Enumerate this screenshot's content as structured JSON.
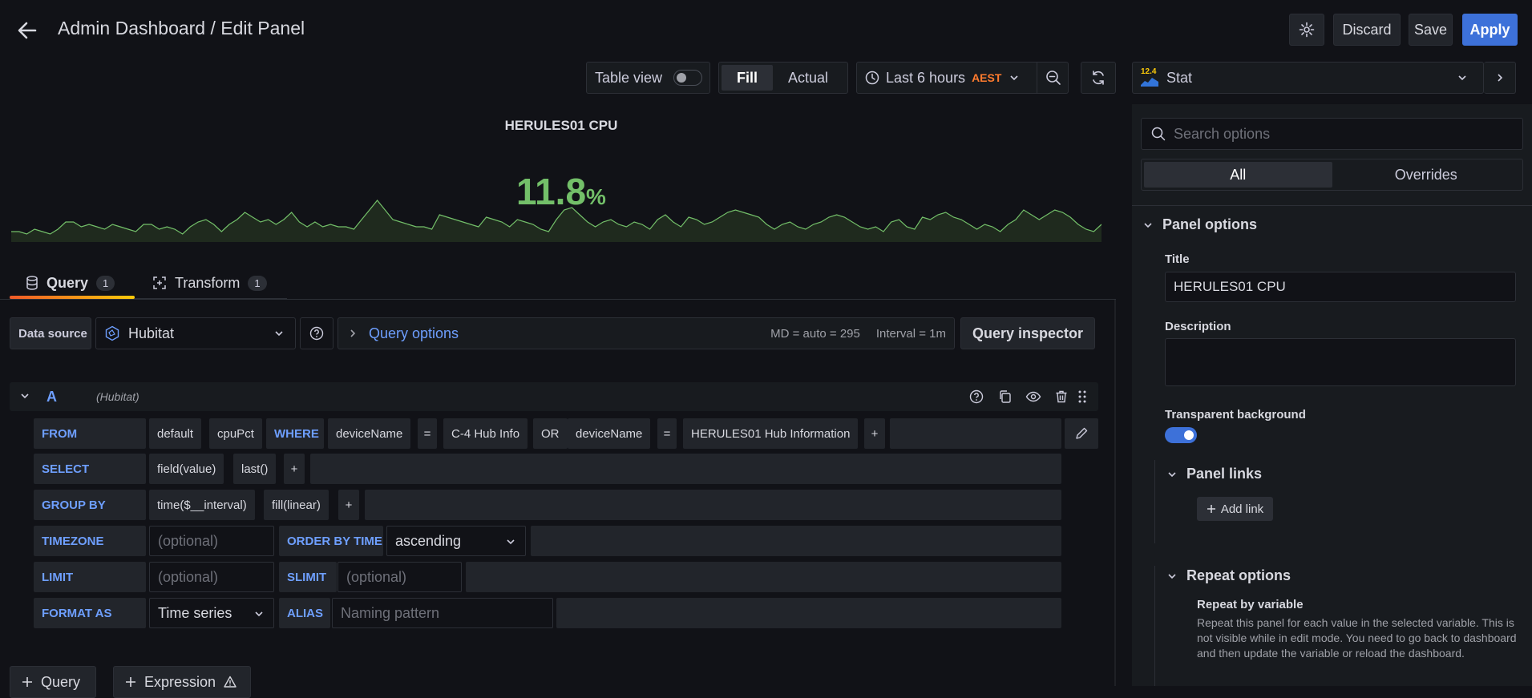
{
  "header": {
    "title": "Admin Dashboard / Edit Panel",
    "discard_label": "Discard",
    "save_label": "Save",
    "apply_label": "Apply"
  },
  "toolbar": {
    "table_view_label": "Table view",
    "table_view_on": false,
    "fill_label": "Fill",
    "actual_label": "Actual",
    "time_range": "Last 6 hours",
    "timezone": "AEST"
  },
  "viz_picker": {
    "badge": "12.4",
    "name": "Stat"
  },
  "panel": {
    "title": "HERULES01 CPU",
    "value": "11.8",
    "unit": "%",
    "accent": "#73bf69",
    "sparkline": [
      3,
      3,
      2,
      4,
      3,
      2,
      4,
      7,
      7,
      5,
      6,
      5,
      4,
      6,
      5,
      4,
      3,
      6,
      6,
      4,
      5,
      4,
      2,
      5,
      7,
      8,
      6,
      3,
      6,
      8,
      11,
      9,
      7,
      8,
      6,
      8,
      11,
      7,
      5,
      7,
      5,
      6,
      5,
      5,
      4,
      8,
      12,
      16,
      12,
      8,
      7,
      6,
      5,
      5,
      4,
      10,
      9,
      8,
      7,
      6,
      5,
      9,
      8,
      7,
      5,
      8,
      7,
      6,
      4,
      3,
      8,
      12,
      13,
      10,
      7,
      5,
      7,
      8,
      6,
      5,
      7,
      6,
      4,
      8,
      10,
      7,
      5,
      9,
      8,
      6,
      7,
      9,
      11,
      12,
      11,
      10,
      9,
      6,
      4,
      6,
      7,
      5,
      4,
      6,
      7,
      9,
      10,
      9,
      7,
      5,
      4,
      5,
      3,
      7,
      8,
      5,
      4,
      9,
      8,
      10,
      11,
      9,
      8,
      6,
      4,
      6,
      5,
      3,
      6,
      8,
      12,
      10,
      8,
      10,
      12,
      11,
      9,
      6,
      4,
      3,
      6
    ],
    "fill_color": "#1f2a1e",
    "line_color": "#73bf69"
  },
  "tabs": [
    {
      "label": "Query",
      "count": "1"
    },
    {
      "label": "Transform",
      "count": "1"
    }
  ],
  "datasource": {
    "label": "Data source",
    "name": "Hubitat"
  },
  "query_options": {
    "title": "Query options",
    "md": "MD = auto = 295",
    "interval": "Interval = 1m",
    "inspector_label": "Query inspector"
  },
  "query": {
    "ref": "A",
    "source": "(Hubitat)",
    "from": {
      "keyword": "FROM",
      "policy": "default",
      "measurement": "cpuPct",
      "where": "WHERE",
      "cond1_key": "deviceName",
      "cond1_op": "=",
      "cond1_val": "C-4 Hub Info",
      "or": "OR",
      "cond2_key": "deviceName",
      "cond2_op": "=",
      "cond2_val": "HERULES01 Hub Information",
      "plus": "+"
    },
    "select": {
      "keyword": "SELECT",
      "field": "field(value)",
      "agg": "last()",
      "plus": "+"
    },
    "group_by": {
      "keyword": "GROUP BY",
      "time": "time($__interval)",
      "fill": "fill(linear)",
      "plus": "+"
    },
    "timezone": {
      "keyword": "TIMEZONE",
      "placeholder": "(optional)",
      "order_keyword": "ORDER BY TIME",
      "order_value": "ascending"
    },
    "limit": {
      "keyword": "LIMIT",
      "placeholder": "(optional)",
      "slimit_keyword": "SLIMIT",
      "slimit_placeholder": "(optional)"
    },
    "format": {
      "keyword": "FORMAT AS",
      "value": "Time series",
      "alias_keyword": "ALIAS",
      "alias_placeholder": "Naming pattern"
    }
  },
  "bottom_buttons": {
    "query_label": "Query",
    "expression_label": "Expression"
  },
  "options": {
    "search_placeholder": "Search options",
    "tab_all": "All",
    "tab_overrides": "Overrides",
    "panel_options": "Panel options",
    "title_label": "Title",
    "title_value": "HERULES01 CPU",
    "description_label": "Description",
    "transparent_label": "Transparent background",
    "transparent_on": true,
    "panel_links": "Panel links",
    "add_link": "Add link",
    "repeat_options": "Repeat options",
    "repeat_by_label": "Repeat by variable",
    "repeat_desc": "Repeat this panel for each value in the selected variable. This is not visible while in edit mode. You need to go back to dashboard and then update the variable or reload the dashboard."
  }
}
